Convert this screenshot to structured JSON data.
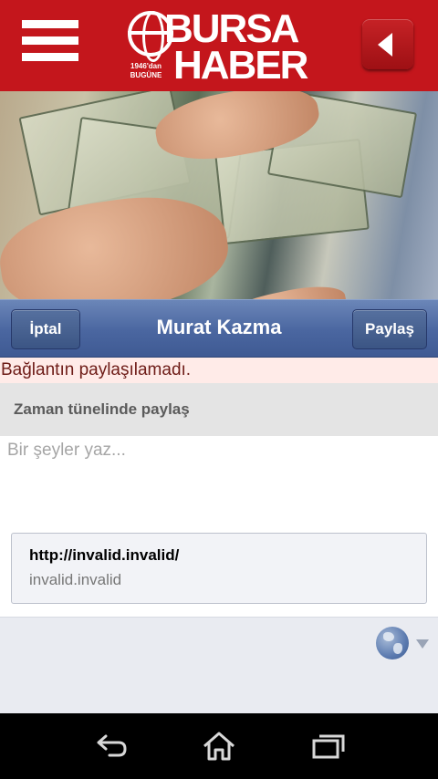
{
  "header": {
    "logo_line1": "BURSA",
    "logo_line2": "HABER",
    "logo_since_line1": "1946'dan",
    "logo_since_line2": "BUGÜNE"
  },
  "share_bar": {
    "cancel_label": "İptal",
    "title": "Murat Kazma",
    "share_label": "Paylaş"
  },
  "error": {
    "message": "Bağlantın paylaşılamadı."
  },
  "composer": {
    "section_title": "Zaman tünelinde paylaş",
    "placeholder": "Bir şeyler yaz...",
    "link": {
      "url": "http://invalid.invalid/",
      "domain": "invalid.invalid"
    }
  },
  "icons": {
    "menu": "hamburger-menu-icon",
    "back": "back-arrow-icon",
    "privacy": "globe-icon",
    "nav_back": "nav-back-icon",
    "nav_home": "home-icon",
    "nav_recent": "recent-apps-icon"
  },
  "colors": {
    "header_red": "#c4161c",
    "facebook_blue": "#4a66a0",
    "error_bg": "#ffebe8",
    "error_text": "#6e1c17"
  }
}
